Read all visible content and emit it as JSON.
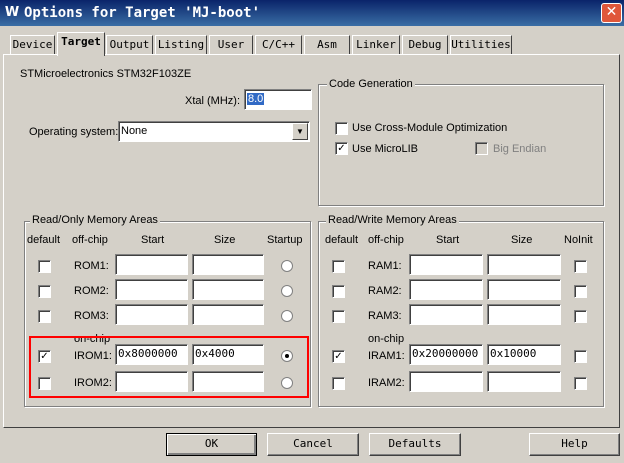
{
  "window": {
    "title": "Options for Target 'MJ-boot'",
    "close_glyph": "✕",
    "icon_glyph": "W"
  },
  "tabs": [
    {
      "label": "Device"
    },
    {
      "label": "Target",
      "active": true
    },
    {
      "label": "Output"
    },
    {
      "label": "Listing"
    },
    {
      "label": "User"
    },
    {
      "label": "C/C++"
    },
    {
      "label": "Asm"
    },
    {
      "label": "Linker"
    },
    {
      "label": "Debug"
    },
    {
      "label": "Utilities"
    }
  ],
  "device": {
    "name": "STMicroelectronics STM32F103ZE"
  },
  "xtal": {
    "label": "Xtal (MHz):",
    "value": "8.0"
  },
  "os": {
    "label": "Operating system:",
    "value": "None"
  },
  "code_generation": {
    "title": "Code Generation",
    "cross_module": {
      "label": "Use Cross-Module Optimization",
      "checked": false
    },
    "microlib": {
      "label": "Use MicroLIB",
      "checked": true
    },
    "big_endian": {
      "label": "Big Endian",
      "checked": false,
      "disabled": true
    }
  },
  "rom": {
    "title": "Read/Only Memory Areas",
    "headers": {
      "default": "default",
      "offchip": "off-chip",
      "start": "Start",
      "size": "Size",
      "startup": "Startup"
    },
    "onchip_label": "on-chip",
    "rows": [
      {
        "label": "ROM1:",
        "default": false,
        "start": "",
        "size": "",
        "startup": false
      },
      {
        "label": "ROM2:",
        "default": false,
        "start": "",
        "size": "",
        "startup": false
      },
      {
        "label": "ROM3:",
        "default": false,
        "start": "",
        "size": "",
        "startup": false
      },
      {
        "label": "IROM1:",
        "default": true,
        "start": "0x8000000",
        "size": "0x4000",
        "startup": true
      },
      {
        "label": "IROM2:",
        "default": false,
        "start": "",
        "size": "",
        "startup": false
      }
    ]
  },
  "ram": {
    "title": "Read/Write Memory Areas",
    "headers": {
      "default": "default",
      "offchip": "off-chip",
      "start": "Start",
      "size": "Size",
      "noinit": "NoInit"
    },
    "onchip_label": "on-chip",
    "rows": [
      {
        "label": "RAM1:",
        "default": false,
        "start": "",
        "size": "",
        "noinit": false
      },
      {
        "label": "RAM2:",
        "default": false,
        "start": "",
        "size": "",
        "noinit": false
      },
      {
        "label": "RAM3:",
        "default": false,
        "start": "",
        "size": "",
        "noinit": false
      },
      {
        "label": "IRAM1:",
        "default": true,
        "start": "0x20000000",
        "size": "0x10000",
        "noinit": false
      },
      {
        "label": "IRAM2:",
        "default": false,
        "start": "",
        "size": "",
        "noinit": false
      }
    ]
  },
  "buttons": {
    "ok": "OK",
    "cancel": "Cancel",
    "defaults": "Defaults",
    "help": "Help"
  },
  "colors": {
    "highlight": "#ff0000",
    "titlebar": "#0a246a",
    "dialog": "#d4d0c8"
  }
}
